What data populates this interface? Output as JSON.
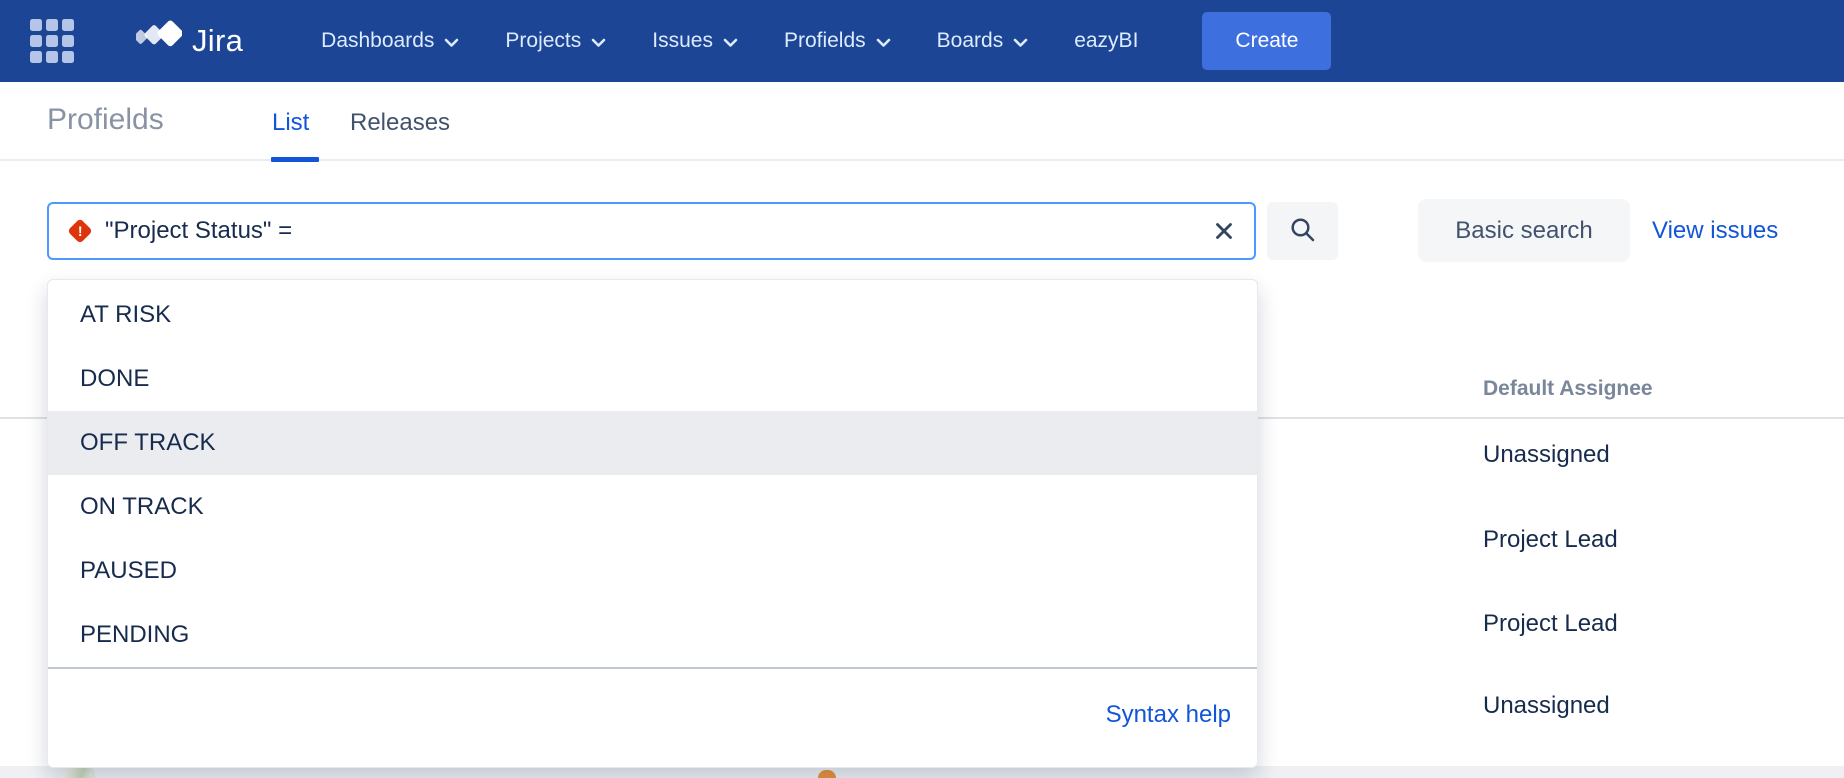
{
  "nav": {
    "brand": "Jira",
    "items": [
      {
        "label": "Dashboards",
        "chevron": true
      },
      {
        "label": "Projects",
        "chevron": true
      },
      {
        "label": "Issues",
        "chevron": true
      },
      {
        "label": "Profields",
        "chevron": true
      },
      {
        "label": "Boards",
        "chevron": true
      },
      {
        "label": "eazyBI",
        "chevron": false
      }
    ],
    "create_label": "Create"
  },
  "header": {
    "title": "Profields",
    "tabs": [
      {
        "label": "List",
        "active": true
      },
      {
        "label": "Releases",
        "active": false
      }
    ]
  },
  "search": {
    "query": "\"Project Status\" = ",
    "basic_search_label": "Basic search",
    "view_issues_label": "View issues",
    "error_glyph": "!"
  },
  "dropdown": {
    "options": [
      "AT RISK",
      "DONE",
      "OFF TRACK",
      "ON TRACK",
      "PAUSED",
      "PENDING"
    ],
    "highlighted_option": "OFF TRACK",
    "footer_link": "Syntax help"
  },
  "table": {
    "column_header": "Default Assignee",
    "rows": [
      "Unassigned",
      "Project Lead",
      "Project Lead",
      "Unassigned"
    ]
  },
  "icons": {
    "app_switcher": "grid-3x3",
    "jira_logo": "jira-mark",
    "nav_chevron": "chevron-down",
    "error": "diamond-exclamation",
    "clear": "x-cross",
    "search": "magnifier"
  },
  "colors": {
    "nav_bg": "#1d4596",
    "accent_blue": "#1155d8",
    "create_button_bg": "#3d70de",
    "input_focus_border": "#4c9aff",
    "error_red": "#de350b",
    "text_navy": "#172b4d",
    "muted_gray": "#7a869a",
    "highlight_row": "#ebecf0"
  }
}
